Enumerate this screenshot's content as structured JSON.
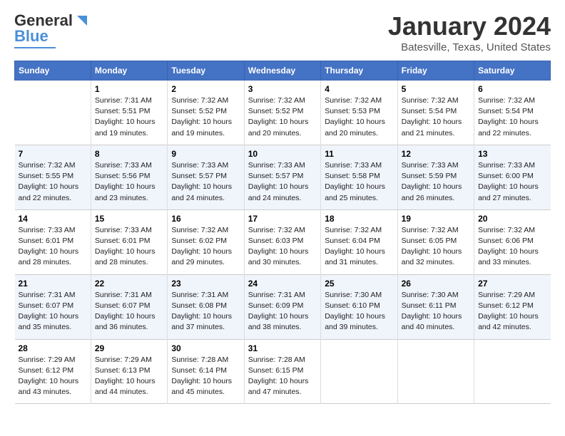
{
  "header": {
    "logo_line1": "General",
    "logo_line2": "Blue",
    "main_title": "January 2024",
    "subtitle": "Batesville, Texas, United States"
  },
  "days_of_week": [
    "Sunday",
    "Monday",
    "Tuesday",
    "Wednesday",
    "Thursday",
    "Friday",
    "Saturday"
  ],
  "weeks": [
    [
      {
        "day": "",
        "info": ""
      },
      {
        "day": "1",
        "info": "Sunrise: 7:31 AM\nSunset: 5:51 PM\nDaylight: 10 hours\nand 19 minutes."
      },
      {
        "day": "2",
        "info": "Sunrise: 7:32 AM\nSunset: 5:52 PM\nDaylight: 10 hours\nand 19 minutes."
      },
      {
        "day": "3",
        "info": "Sunrise: 7:32 AM\nSunset: 5:52 PM\nDaylight: 10 hours\nand 20 minutes."
      },
      {
        "day": "4",
        "info": "Sunrise: 7:32 AM\nSunset: 5:53 PM\nDaylight: 10 hours\nand 20 minutes."
      },
      {
        "day": "5",
        "info": "Sunrise: 7:32 AM\nSunset: 5:54 PM\nDaylight: 10 hours\nand 21 minutes."
      },
      {
        "day": "6",
        "info": "Sunrise: 7:32 AM\nSunset: 5:54 PM\nDaylight: 10 hours\nand 22 minutes."
      }
    ],
    [
      {
        "day": "7",
        "info": "Sunrise: 7:32 AM\nSunset: 5:55 PM\nDaylight: 10 hours\nand 22 minutes."
      },
      {
        "day": "8",
        "info": "Sunrise: 7:33 AM\nSunset: 5:56 PM\nDaylight: 10 hours\nand 23 minutes."
      },
      {
        "day": "9",
        "info": "Sunrise: 7:33 AM\nSunset: 5:57 PM\nDaylight: 10 hours\nand 24 minutes."
      },
      {
        "day": "10",
        "info": "Sunrise: 7:33 AM\nSunset: 5:57 PM\nDaylight: 10 hours\nand 24 minutes."
      },
      {
        "day": "11",
        "info": "Sunrise: 7:33 AM\nSunset: 5:58 PM\nDaylight: 10 hours\nand 25 minutes."
      },
      {
        "day": "12",
        "info": "Sunrise: 7:33 AM\nSunset: 5:59 PM\nDaylight: 10 hours\nand 26 minutes."
      },
      {
        "day": "13",
        "info": "Sunrise: 7:33 AM\nSunset: 6:00 PM\nDaylight: 10 hours\nand 27 minutes."
      }
    ],
    [
      {
        "day": "14",
        "info": "Sunrise: 7:33 AM\nSunset: 6:01 PM\nDaylight: 10 hours\nand 28 minutes."
      },
      {
        "day": "15",
        "info": "Sunrise: 7:33 AM\nSunset: 6:01 PM\nDaylight: 10 hours\nand 28 minutes."
      },
      {
        "day": "16",
        "info": "Sunrise: 7:32 AM\nSunset: 6:02 PM\nDaylight: 10 hours\nand 29 minutes."
      },
      {
        "day": "17",
        "info": "Sunrise: 7:32 AM\nSunset: 6:03 PM\nDaylight: 10 hours\nand 30 minutes."
      },
      {
        "day": "18",
        "info": "Sunrise: 7:32 AM\nSunset: 6:04 PM\nDaylight: 10 hours\nand 31 minutes."
      },
      {
        "day": "19",
        "info": "Sunrise: 7:32 AM\nSunset: 6:05 PM\nDaylight: 10 hours\nand 32 minutes."
      },
      {
        "day": "20",
        "info": "Sunrise: 7:32 AM\nSunset: 6:06 PM\nDaylight: 10 hours\nand 33 minutes."
      }
    ],
    [
      {
        "day": "21",
        "info": "Sunrise: 7:31 AM\nSunset: 6:07 PM\nDaylight: 10 hours\nand 35 minutes."
      },
      {
        "day": "22",
        "info": "Sunrise: 7:31 AM\nSunset: 6:07 PM\nDaylight: 10 hours\nand 36 minutes."
      },
      {
        "day": "23",
        "info": "Sunrise: 7:31 AM\nSunset: 6:08 PM\nDaylight: 10 hours\nand 37 minutes."
      },
      {
        "day": "24",
        "info": "Sunrise: 7:31 AM\nSunset: 6:09 PM\nDaylight: 10 hours\nand 38 minutes."
      },
      {
        "day": "25",
        "info": "Sunrise: 7:30 AM\nSunset: 6:10 PM\nDaylight: 10 hours\nand 39 minutes."
      },
      {
        "day": "26",
        "info": "Sunrise: 7:30 AM\nSunset: 6:11 PM\nDaylight: 10 hours\nand 40 minutes."
      },
      {
        "day": "27",
        "info": "Sunrise: 7:29 AM\nSunset: 6:12 PM\nDaylight: 10 hours\nand 42 minutes."
      }
    ],
    [
      {
        "day": "28",
        "info": "Sunrise: 7:29 AM\nSunset: 6:12 PM\nDaylight: 10 hours\nand 43 minutes."
      },
      {
        "day": "29",
        "info": "Sunrise: 7:29 AM\nSunset: 6:13 PM\nDaylight: 10 hours\nand 44 minutes."
      },
      {
        "day": "30",
        "info": "Sunrise: 7:28 AM\nSunset: 6:14 PM\nDaylight: 10 hours\nand 45 minutes."
      },
      {
        "day": "31",
        "info": "Sunrise: 7:28 AM\nSunset: 6:15 PM\nDaylight: 10 hours\nand 47 minutes."
      },
      {
        "day": "",
        "info": ""
      },
      {
        "day": "",
        "info": ""
      },
      {
        "day": "",
        "info": ""
      }
    ]
  ]
}
